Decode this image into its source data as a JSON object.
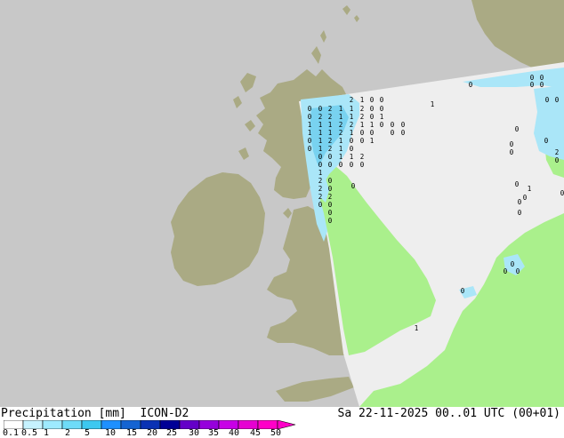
{
  "header": {
    "title": "Precipitation [mm]  ICON-D2",
    "valid_time": "Sa 22-11-2025 00..01 UTC (00+01)"
  },
  "legend": {
    "ticks": [
      "0.1",
      "0.5",
      "1",
      "2",
      "5",
      "10",
      "15",
      "20",
      "25",
      "30",
      "35",
      "40",
      "45",
      "50"
    ],
    "colors": [
      "#ffffff",
      "#c6f2ff",
      "#9eeaff",
      "#6edcf8",
      "#3cc8f0",
      "#1e90ff",
      "#1464d2",
      "#0a32b4",
      "#000096",
      "#6400c8",
      "#9600dc",
      "#c800e6",
      "#e600d2",
      "#ff00c8"
    ]
  },
  "map": {
    "colors": {
      "sea_outside_domain": "#c8c8c8",
      "land_outside_domain": "#aaaa84",
      "domain_no_data": "#eeeeee",
      "land_in_domain": "#aaf08c",
      "precip_light": "#aae6f8",
      "precip_mid": "#78d2f0"
    },
    "grid_value_labels": [
      "2",
      "1",
      "0",
      "0",
      "0",
      "0",
      "2",
      "1",
      "1",
      "2",
      "0",
      "0",
      "0",
      "2",
      "2",
      "1",
      "1",
      "2",
      "0",
      "1",
      "1",
      "1",
      "1",
      "2",
      "2",
      "1",
      "1",
      "0",
      "0",
      "0",
      "1",
      "1",
      "1",
      "2",
      "1",
      "0",
      "0",
      "0",
      "0",
      "0",
      "1",
      "2",
      "1",
      "0",
      "0",
      "1",
      "0",
      "1",
      "2",
      "1",
      "0",
      "0",
      "0",
      "1",
      "1",
      "2",
      "0",
      "0",
      "0",
      "0",
      "0",
      "1",
      "2",
      "0",
      "2",
      "0",
      "2",
      "2",
      "0",
      "0",
      "0",
      "0",
      "0",
      "1",
      "0",
      "0",
      "0",
      "0",
      "0",
      "0",
      "0",
      "0",
      "0",
      "0",
      "2",
      "0",
      "0",
      "0",
      "1",
      "0",
      "0",
      "0",
      "0",
      "0",
      "0",
      "0",
      "0",
      "1"
    ]
  }
}
